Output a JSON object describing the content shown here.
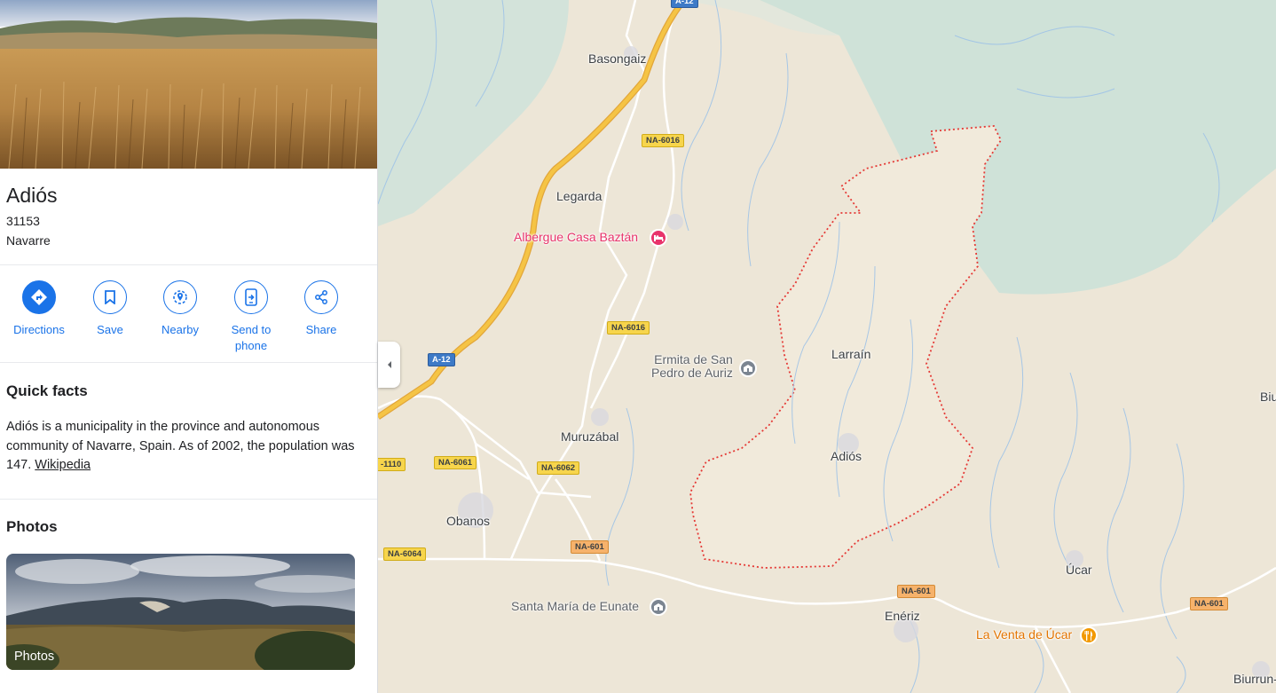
{
  "place": {
    "name": "Adiós",
    "postal_code": "31153",
    "region": "Navarre"
  },
  "actions": [
    {
      "label": "Directions",
      "icon": "directions-icon"
    },
    {
      "label": "Save",
      "icon": "bookmark-icon"
    },
    {
      "label": "Nearby",
      "icon": "nearby-icon"
    },
    {
      "label": "Send to phone",
      "icon": "send-to-phone-icon"
    },
    {
      "label": "Share",
      "icon": "share-icon"
    }
  ],
  "quick_facts": {
    "title": "Quick facts",
    "text": "Adiós is a municipality in the province and autonomous community of Navarre, Spain. As of 2002, the population was 147.",
    "link": "Wikipedia"
  },
  "photos": {
    "title": "Photos",
    "card_label": "Photos"
  },
  "map": {
    "places": {
      "basongaiz": "Basongaiz",
      "legarda": "Legarda",
      "larrain": "Larraín",
      "adios": "Adiós",
      "muruzabal": "Muruzábal",
      "obanos": "Obanos",
      "eneriz": "Enériz",
      "ucar": "Úcar",
      "biu": "Biu",
      "biurrun": "Biurrun-"
    },
    "pois": {
      "albergue": "Albergue Casa Baztán",
      "ermita_line1": "Ermita de San",
      "ermita_line2": "Pedro de Auriz",
      "santa_maria": "Santa María de Eunate",
      "la_venta": "La Venta de Úcar"
    },
    "roads": {
      "a12_top": "A-12",
      "a12": "A-12",
      "na6016_a": "NA-6016",
      "na6016_b": "NA-6016",
      "na6061": "NA-6061",
      "na6062": "NA-6062",
      "na601_a": "NA-601",
      "na601_b": "NA-601",
      "na601_c": "NA-601",
      "na6064": "NA-6064",
      "n1110": "-1110"
    },
    "colors": {
      "land": "#ede6d7",
      "selected_area": "#f1eadb",
      "forest": "#cfe2d8",
      "boundary": "#e53935",
      "highway": "#f5c445",
      "poi_pink": "#e8336b",
      "poi_gray": "#7b8591",
      "poi_orange": "#f29900",
      "accent": "#1a73e8"
    }
  }
}
